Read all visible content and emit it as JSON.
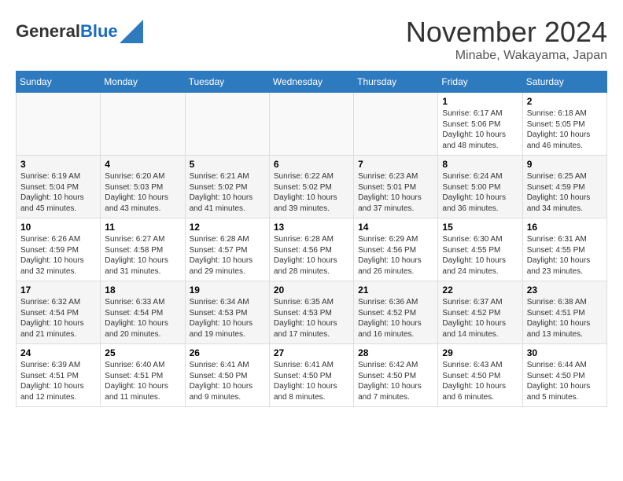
{
  "header": {
    "logo": {
      "general": "General",
      "blue": "Blue"
    },
    "title": "November 2024",
    "subtitle": "Minabe, Wakayama, Japan"
  },
  "calendar": {
    "days_of_week": [
      "Sunday",
      "Monday",
      "Tuesday",
      "Wednesday",
      "Thursday",
      "Friday",
      "Saturday"
    ],
    "weeks": [
      [
        {
          "day": "",
          "info": ""
        },
        {
          "day": "",
          "info": ""
        },
        {
          "day": "",
          "info": ""
        },
        {
          "day": "",
          "info": ""
        },
        {
          "day": "",
          "info": ""
        },
        {
          "day": "1",
          "info": "Sunrise: 6:17 AM\nSunset: 5:06 PM\nDaylight: 10 hours\nand 48 minutes."
        },
        {
          "day": "2",
          "info": "Sunrise: 6:18 AM\nSunset: 5:05 PM\nDaylight: 10 hours\nand 46 minutes."
        }
      ],
      [
        {
          "day": "3",
          "info": "Sunrise: 6:19 AM\nSunset: 5:04 PM\nDaylight: 10 hours\nand 45 minutes."
        },
        {
          "day": "4",
          "info": "Sunrise: 6:20 AM\nSunset: 5:03 PM\nDaylight: 10 hours\nand 43 minutes."
        },
        {
          "day": "5",
          "info": "Sunrise: 6:21 AM\nSunset: 5:02 PM\nDaylight: 10 hours\nand 41 minutes."
        },
        {
          "day": "6",
          "info": "Sunrise: 6:22 AM\nSunset: 5:02 PM\nDaylight: 10 hours\nand 39 minutes."
        },
        {
          "day": "7",
          "info": "Sunrise: 6:23 AM\nSunset: 5:01 PM\nDaylight: 10 hours\nand 37 minutes."
        },
        {
          "day": "8",
          "info": "Sunrise: 6:24 AM\nSunset: 5:00 PM\nDaylight: 10 hours\nand 36 minutes."
        },
        {
          "day": "9",
          "info": "Sunrise: 6:25 AM\nSunset: 4:59 PM\nDaylight: 10 hours\nand 34 minutes."
        }
      ],
      [
        {
          "day": "10",
          "info": "Sunrise: 6:26 AM\nSunset: 4:59 PM\nDaylight: 10 hours\nand 32 minutes."
        },
        {
          "day": "11",
          "info": "Sunrise: 6:27 AM\nSunset: 4:58 PM\nDaylight: 10 hours\nand 31 minutes."
        },
        {
          "day": "12",
          "info": "Sunrise: 6:28 AM\nSunset: 4:57 PM\nDaylight: 10 hours\nand 29 minutes."
        },
        {
          "day": "13",
          "info": "Sunrise: 6:28 AM\nSunset: 4:56 PM\nDaylight: 10 hours\nand 28 minutes."
        },
        {
          "day": "14",
          "info": "Sunrise: 6:29 AM\nSunset: 4:56 PM\nDaylight: 10 hours\nand 26 minutes."
        },
        {
          "day": "15",
          "info": "Sunrise: 6:30 AM\nSunset: 4:55 PM\nDaylight: 10 hours\nand 24 minutes."
        },
        {
          "day": "16",
          "info": "Sunrise: 6:31 AM\nSunset: 4:55 PM\nDaylight: 10 hours\nand 23 minutes."
        }
      ],
      [
        {
          "day": "17",
          "info": "Sunrise: 6:32 AM\nSunset: 4:54 PM\nDaylight: 10 hours\nand 21 minutes."
        },
        {
          "day": "18",
          "info": "Sunrise: 6:33 AM\nSunset: 4:54 PM\nDaylight: 10 hours\nand 20 minutes."
        },
        {
          "day": "19",
          "info": "Sunrise: 6:34 AM\nSunset: 4:53 PM\nDaylight: 10 hours\nand 19 minutes."
        },
        {
          "day": "20",
          "info": "Sunrise: 6:35 AM\nSunset: 4:53 PM\nDaylight: 10 hours\nand 17 minutes."
        },
        {
          "day": "21",
          "info": "Sunrise: 6:36 AM\nSunset: 4:52 PM\nDaylight: 10 hours\nand 16 minutes."
        },
        {
          "day": "22",
          "info": "Sunrise: 6:37 AM\nSunset: 4:52 PM\nDaylight: 10 hours\nand 14 minutes."
        },
        {
          "day": "23",
          "info": "Sunrise: 6:38 AM\nSunset: 4:51 PM\nDaylight: 10 hours\nand 13 minutes."
        }
      ],
      [
        {
          "day": "24",
          "info": "Sunrise: 6:39 AM\nSunset: 4:51 PM\nDaylight: 10 hours\nand 12 minutes."
        },
        {
          "day": "25",
          "info": "Sunrise: 6:40 AM\nSunset: 4:51 PM\nDaylight: 10 hours\nand 11 minutes."
        },
        {
          "day": "26",
          "info": "Sunrise: 6:41 AM\nSunset: 4:50 PM\nDaylight: 10 hours\nand 9 minutes."
        },
        {
          "day": "27",
          "info": "Sunrise: 6:41 AM\nSunset: 4:50 PM\nDaylight: 10 hours\nand 8 minutes."
        },
        {
          "day": "28",
          "info": "Sunrise: 6:42 AM\nSunset: 4:50 PM\nDaylight: 10 hours\nand 7 minutes."
        },
        {
          "day": "29",
          "info": "Sunrise: 6:43 AM\nSunset: 4:50 PM\nDaylight: 10 hours\nand 6 minutes."
        },
        {
          "day": "30",
          "info": "Sunrise: 6:44 AM\nSunset: 4:50 PM\nDaylight: 10 hours\nand 5 minutes."
        }
      ]
    ]
  }
}
